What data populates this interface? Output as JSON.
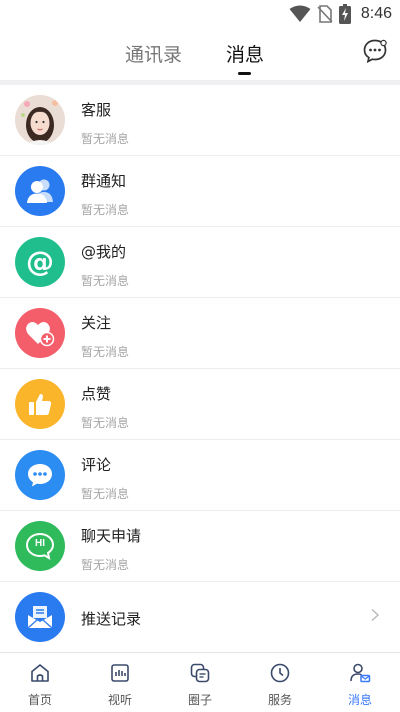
{
  "status_bar": {
    "time": "8:46",
    "icons": [
      "wifi-icon",
      "no-sim-icon",
      "battery-charging-icon"
    ]
  },
  "header": {
    "tabs": [
      {
        "label": "通讯录",
        "active": false
      },
      {
        "label": "消息",
        "active": true
      }
    ],
    "right_icon": "chat-bubble-icon"
  },
  "messages": [
    {
      "title": "客服",
      "subtitle": "暂无消息",
      "icon": "customer-service-avatar",
      "color": "#e8d6cf"
    },
    {
      "title": "群通知",
      "subtitle": "暂无消息",
      "icon": "group-icon",
      "color": "#2b7bf0"
    },
    {
      "title": "@我的",
      "subtitle": "暂无消息",
      "icon": "at-sign-icon",
      "color": "#1fbe8c"
    },
    {
      "title": "关注",
      "subtitle": "暂无消息",
      "icon": "heart-plus-icon",
      "color": "#f45d6a"
    },
    {
      "title": "点赞",
      "subtitle": "暂无消息",
      "icon": "thumbs-up-icon",
      "color": "#fbb52b"
    },
    {
      "title": "评论",
      "subtitle": "暂无消息",
      "icon": "comment-icon",
      "color": "#2b8cf2"
    },
    {
      "title": "聊天申请",
      "subtitle": "暂无消息",
      "icon": "chat-request-icon",
      "color": "#2fbb5b",
      "icon_text": "HI"
    },
    {
      "title": "推送记录",
      "icon": "push-record-icon",
      "color": "#2b7bf0"
    }
  ],
  "bottom_nav": [
    {
      "label": "首页",
      "icon": "home-icon",
      "active": false
    },
    {
      "label": "视听",
      "icon": "media-icon",
      "active": false
    },
    {
      "label": "圈子",
      "icon": "circle-icon",
      "active": false
    },
    {
      "label": "服务",
      "icon": "clock-icon",
      "active": false
    },
    {
      "label": "消息",
      "icon": "message-icon",
      "active": true
    }
  ],
  "colors": {
    "accent": "#3a7afe",
    "nav_icon": "#3b4a6b"
  }
}
